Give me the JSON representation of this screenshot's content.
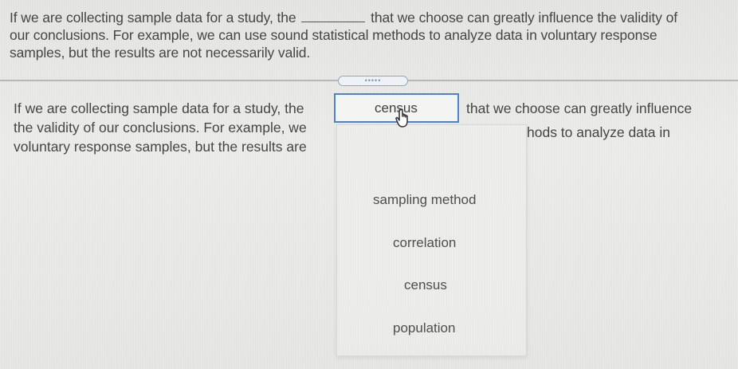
{
  "question": {
    "before_blank": "If we are collecting sample data for a study, the",
    "after_blank": "that we choose can greatly influence the validity of",
    "line2": "our conclusions. For example, we can use sound statistical methods to analyze data in voluntary response",
    "line3": "samples, but the results are not necessarily valid."
  },
  "answer": {
    "left_line1": "If we are collecting sample data for a study, the",
    "left_line2": "the validity of our conclusions. For example, we",
    "left_line3": "voluntary response samples, but the results are",
    "right_line1": "that we choose can greatly influence",
    "right_line2": "hods to analyze data in"
  },
  "select": {
    "current_value": "census",
    "options": [
      "sampling method",
      "correlation",
      "census",
      "population"
    ]
  },
  "divider_handle": "•••••",
  "colors": {
    "select_border": "#4b84c8",
    "text": "#454545"
  }
}
